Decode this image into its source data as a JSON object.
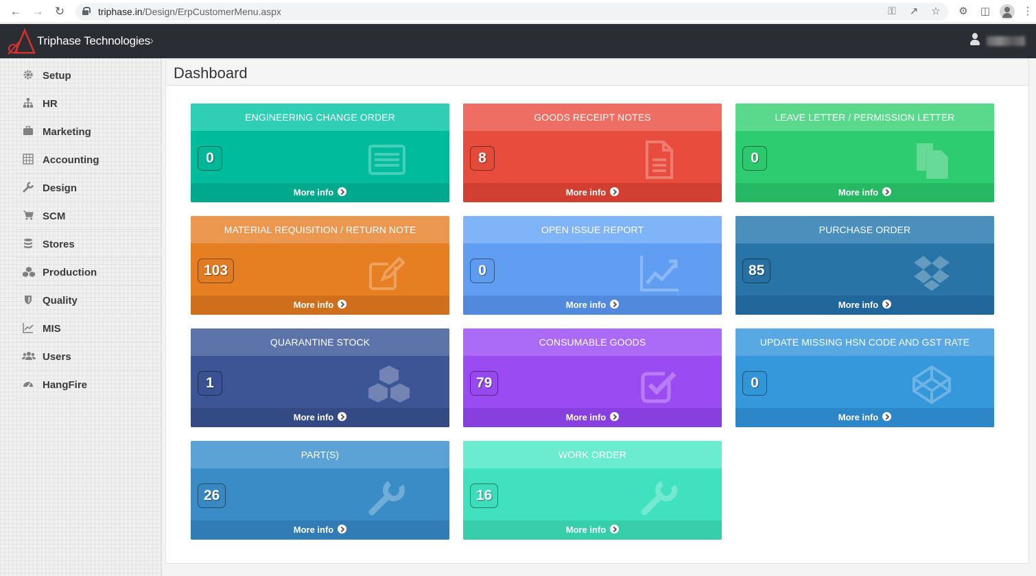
{
  "browser": {
    "url_host": "triphase.in",
    "url_path": "/Design/ErpCustomerMenu.aspx"
  },
  "header": {
    "brand": "Triphase Technologies",
    "chevron": "›"
  },
  "sidebar": {
    "items": [
      {
        "label": "Setup",
        "icon": "gear-icon"
      },
      {
        "label": "HR",
        "icon": "sitemap-icon"
      },
      {
        "label": "Marketing",
        "icon": "briefcase-icon"
      },
      {
        "label": "Accounting",
        "icon": "calculator-icon"
      },
      {
        "label": "Design",
        "icon": "wrench-icon"
      },
      {
        "label": "SCM",
        "icon": "cart-icon"
      },
      {
        "label": "Stores",
        "icon": "database-icon"
      },
      {
        "label": "Production",
        "icon": "cubes-icon"
      },
      {
        "label": "Quality",
        "icon": "shield-icon"
      },
      {
        "label": "MIS",
        "icon": "line-chart-icon"
      },
      {
        "label": "Users",
        "icon": "users-icon"
      },
      {
        "label": "HangFire",
        "icon": "dashboard-icon"
      }
    ]
  },
  "main": {
    "title": "Dashboard",
    "more_label": "More info",
    "tiles": [
      {
        "title": "ENGINEERING CHANGE ORDER",
        "count": "0",
        "icon": "list-card-icon",
        "colors": {
          "head": "#2fcfb6",
          "body": "#00bc9c",
          "foot": "#00a98c"
        }
      },
      {
        "title": "GOODS RECEIPT NOTES",
        "count": "8",
        "icon": "document-icon",
        "colors": {
          "head": "#ee6e63",
          "body": "#e74c3c",
          "foot": "#d13f31"
        }
      },
      {
        "title": "LEAVE LETTER / PERMISSION LETTER",
        "count": "0",
        "icon": "files-icon",
        "colors": {
          "head": "#5ad88c",
          "body": "#2ecc71",
          "foot": "#27b863"
        }
      },
      {
        "title": "MATERIAL REQUISITION / RETURN NOTE",
        "count": "103",
        "icon": "edit-icon",
        "colors": {
          "head": "#eb974f",
          "body": "#e67e22",
          "foot": "#d06f1b"
        }
      },
      {
        "title": "OPEN ISSUE REPORT",
        "count": "0",
        "icon": "area-chart-icon",
        "colors": {
          "head": "#7fb4f8",
          "body": "#609ef2",
          "foot": "#5189dd"
        }
      },
      {
        "title": "PURCHASE ORDER",
        "count": "85",
        "icon": "dropbox-icon",
        "colors": {
          "head": "#4b8fbd",
          "body": "#2874a6",
          "foot": "#21669a"
        }
      },
      {
        "title": "QUARANTINE STOCK",
        "count": "1",
        "icon": "cubes-icon",
        "colors": {
          "head": "#5d74aa",
          "body": "#3b5595",
          "foot": "#334a84"
        }
      },
      {
        "title": "CONSUMABLE GOODS",
        "count": "79",
        "icon": "check-square-icon",
        "colors": {
          "head": "#ac6bf6",
          "body": "#9a4bf2",
          "foot": "#8740de"
        }
      },
      {
        "title": "UPDATE MISSING HSN CODE AND GST RATE",
        "count": "0",
        "icon": "codepen-icon",
        "colors": {
          "head": "#58a8e4",
          "body": "#3498db",
          "foot": "#2d86c7"
        }
      },
      {
        "title": "PART(S)",
        "count": "26",
        "icon": "wrench-icon",
        "colors": {
          "head": "#5aa3d4",
          "body": "#3a8cc6",
          "foot": "#317cb4"
        }
      },
      {
        "title": "WORK ORDER",
        "count": "16",
        "icon": "wrench-icon",
        "colors": {
          "head": "#6aedcf",
          "body": "#40e1be",
          "foot": "#36cfaa"
        }
      }
    ]
  }
}
